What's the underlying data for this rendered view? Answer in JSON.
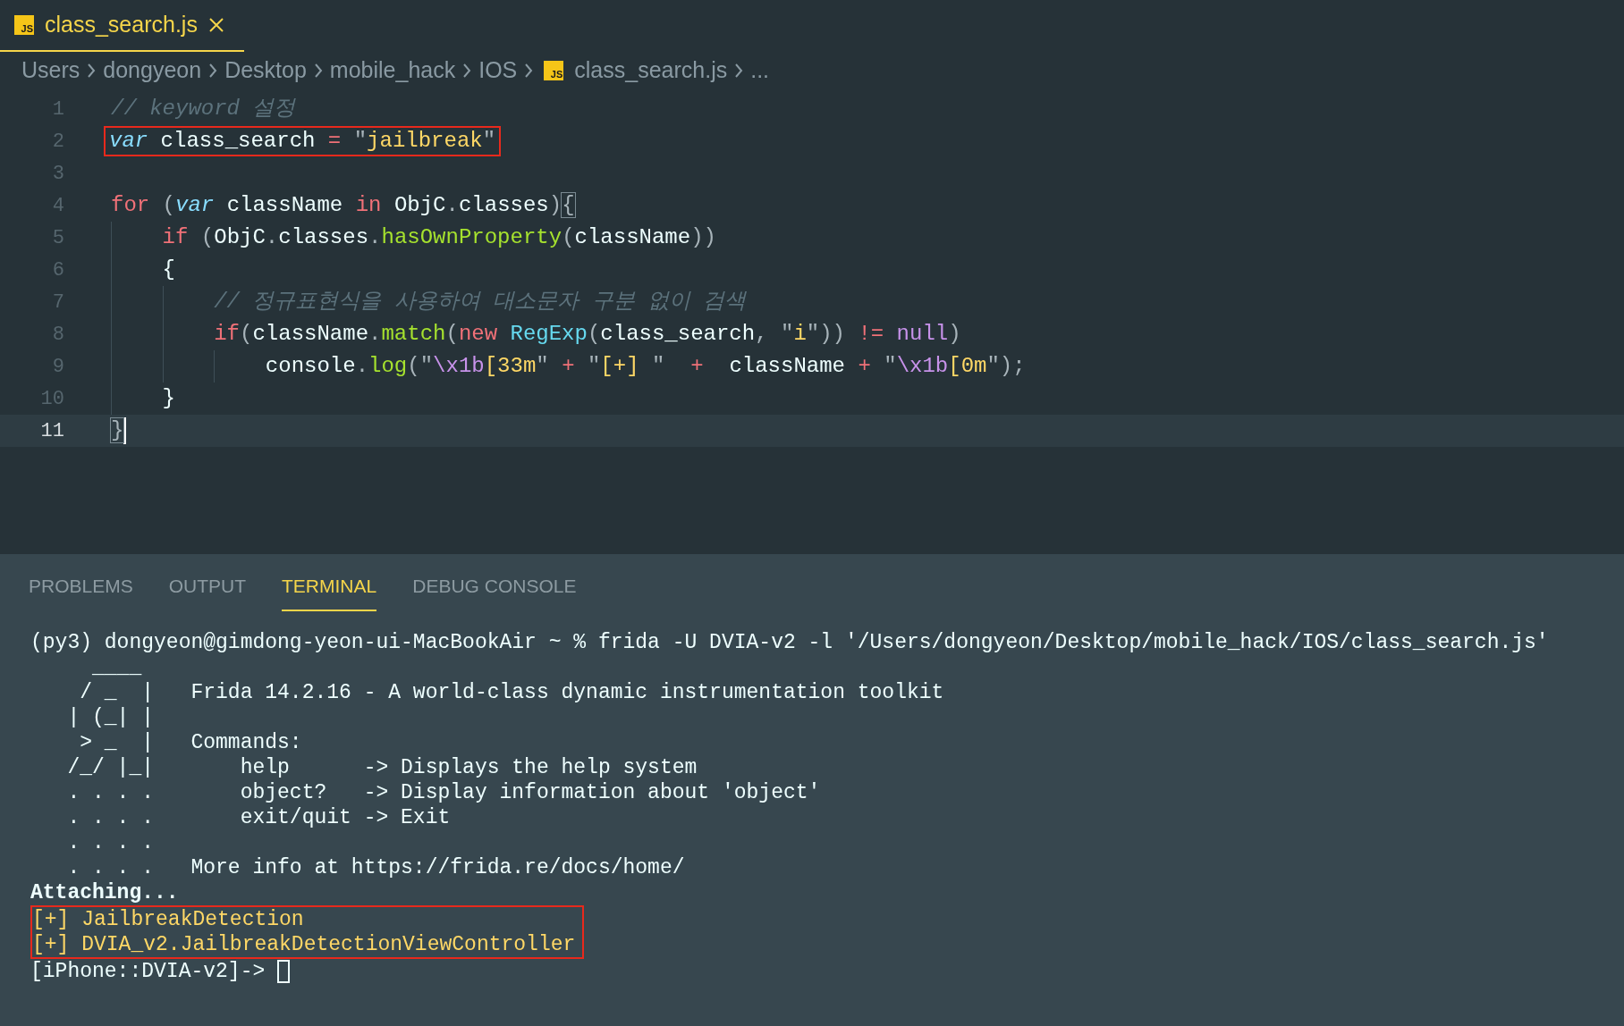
{
  "tabs": [
    {
      "label": "class_search.js",
      "icon_text": "JS",
      "selected": true
    }
  ],
  "breadcrumbs": [
    {
      "kind": "folder",
      "label": "Users"
    },
    {
      "kind": "folder",
      "label": "dongyeon"
    },
    {
      "kind": "folder",
      "label": "Desktop"
    },
    {
      "kind": "folder",
      "label": "mobile_hack"
    },
    {
      "kind": "folder",
      "label": "IOS"
    },
    {
      "kind": "file",
      "label": "class_search.js",
      "icon_text": "JS"
    },
    {
      "kind": "more",
      "label": "..."
    }
  ],
  "code": {
    "lines": [
      {
        "number": "1",
        "current": false,
        "highlighted": false,
        "tokens": [
          {
            "kind": "comment",
            "text": "// keyword 설정"
          }
        ]
      },
      {
        "number": "2",
        "current": false,
        "highlighted": true,
        "tokens": [
          {
            "kind": "storage",
            "text": "var"
          },
          {
            "kind": "plain",
            "text": " class_search "
          },
          {
            "kind": "operator",
            "text": "="
          },
          {
            "kind": "punct",
            "text": " \""
          },
          {
            "kind": "string",
            "text": "jailbreak"
          },
          {
            "kind": "punct",
            "text": "\""
          }
        ]
      },
      {
        "number": "3",
        "current": false,
        "highlighted": false
      },
      {
        "number": "4",
        "current": false,
        "highlighted": false,
        "tokens": [
          {
            "kind": "keyword",
            "text": "for"
          },
          {
            "kind": "punct",
            "text": " ("
          },
          {
            "kind": "storage",
            "text": "var"
          },
          {
            "kind": "plain",
            "text": " className "
          },
          {
            "kind": "keyword",
            "text": "in"
          },
          {
            "kind": "plain",
            "text": " ObjC"
          },
          {
            "kind": "punct",
            "text": "."
          },
          {
            "kind": "plain",
            "text": "classes"
          },
          {
            "kind": "punct",
            "text": ")"
          },
          {
            "kind": "bracket",
            "text": "{"
          }
        ]
      },
      {
        "number": "5",
        "current": false,
        "highlighted": false,
        "tokens": [
          {
            "kind": "keyword",
            "text": "    if"
          },
          {
            "kind": "punct",
            "text": " ("
          },
          {
            "kind": "plain",
            "text": "ObjC"
          },
          {
            "kind": "punct",
            "text": "."
          },
          {
            "kind": "plain",
            "text": "classes"
          },
          {
            "kind": "punct",
            "text": "."
          },
          {
            "kind": "function",
            "text": "hasOwnProperty"
          },
          {
            "kind": "punct",
            "text": "("
          },
          {
            "kind": "plain",
            "text": "className"
          },
          {
            "kind": "punct",
            "text": "))"
          }
        ]
      },
      {
        "number": "6",
        "current": false,
        "highlighted": false,
        "tokens": [
          {
            "kind": "plain",
            "text": "    {"
          }
        ]
      },
      {
        "number": "7",
        "current": false,
        "highlighted": false,
        "tokens": [
          {
            "kind": "comment",
            "text": "        // 정규표현식을 사용하여 대소문자 구분 없이 검색"
          }
        ]
      },
      {
        "number": "8",
        "current": false,
        "highlighted": false,
        "tokens": [
          {
            "kind": "keyword",
            "text": "        if"
          },
          {
            "kind": "punct",
            "text": "("
          },
          {
            "kind": "plain",
            "text": "className"
          },
          {
            "kind": "punct",
            "text": "."
          },
          {
            "kind": "function",
            "text": "match"
          },
          {
            "kind": "punct",
            "text": "("
          },
          {
            "kind": "keyword",
            "text": "new "
          },
          {
            "kind": "class",
            "text": "RegExp"
          },
          {
            "kind": "punct",
            "text": "("
          },
          {
            "kind": "plain",
            "text": "class_search"
          },
          {
            "kind": "punct",
            "text": ", \""
          },
          {
            "kind": "string",
            "text": "i"
          },
          {
            "kind": "punct",
            "text": "\")) "
          },
          {
            "kind": "operator",
            "text": "!= "
          },
          {
            "kind": "constant",
            "text": "null"
          },
          {
            "kind": "punct",
            "text": ")"
          }
        ]
      },
      {
        "number": "9",
        "current": false,
        "highlighted": false,
        "tokens": [
          {
            "kind": "plain",
            "text": "            console"
          },
          {
            "kind": "punct",
            "text": "."
          },
          {
            "kind": "function",
            "text": "log"
          },
          {
            "kind": "punct",
            "text": "(\""
          },
          {
            "kind": "escape",
            "text": "\\x1b"
          },
          {
            "kind": "string",
            "text": "[33m"
          },
          {
            "kind": "punct",
            "text": "\" "
          },
          {
            "kind": "operator",
            "text": "+ "
          },
          {
            "kind": "punct",
            "text": "\""
          },
          {
            "kind": "string",
            "text": "[+] "
          },
          {
            "kind": "punct",
            "text": "\"  "
          },
          {
            "kind": "operator",
            "text": "+"
          },
          {
            "kind": "plain",
            "text": "  className "
          },
          {
            "kind": "operator",
            "text": "+ "
          },
          {
            "kind": "punct",
            "text": "\""
          },
          {
            "kind": "escape",
            "text": "\\x1b"
          },
          {
            "kind": "string",
            "text": "[0m"
          },
          {
            "kind": "punct",
            "text": "\");"
          }
        ]
      },
      {
        "number": "10",
        "current": false,
        "highlighted": false,
        "tokens": [
          {
            "kind": "plain",
            "text": "    }"
          }
        ]
      },
      {
        "number": "11",
        "current": true,
        "highlighted": false,
        "tokens": [
          {
            "kind": "bracket",
            "text": "}"
          }
        ]
      }
    ]
  },
  "panel_tabs": [
    {
      "label": "PROBLEMS",
      "selected": false
    },
    {
      "label": "OUTPUT",
      "selected": false
    },
    {
      "label": "TERMINAL",
      "selected": true
    },
    {
      "label": "DEBUG CONSOLE",
      "selected": false
    }
  ],
  "terminal": {
    "lines": [
      {
        "kind": "text",
        "text": "(py3) dongyeon@gimdong-yeon-ui-MacBookAir ~ % frida -U DVIA-v2 -l '/Users/dongyeon/Desktop/mobile_hack/IOS/class_search.js'"
      },
      {
        "kind": "text",
        "text": "     ____"
      },
      {
        "kind": "text",
        "text": "    / _  |   Frida 14.2.16 - A world-class dynamic instrumentation toolkit"
      },
      {
        "kind": "text",
        "text": "   | (_| |"
      },
      {
        "kind": "text",
        "text": "    > _  |   Commands:"
      },
      {
        "kind": "text",
        "text": "   /_/ |_|       help      -> Displays the help system"
      },
      {
        "kind": "text",
        "text": "   . . . .       object?   -> Display information about 'object'"
      },
      {
        "kind": "text",
        "text": "   . . . .       exit/quit -> Exit"
      },
      {
        "kind": "text",
        "text": "   . . . ."
      },
      {
        "kind": "text",
        "text": "   . . . .   More info at https://frida.re/docs/home/"
      },
      {
        "kind": "bold",
        "text": "Attaching..."
      },
      {
        "kind": "boxed",
        "lines": [
          "[+] JailbreakDetection",
          "[+] DVIA_v2.JailbreakDetectionViewController"
        ]
      },
      {
        "kind": "prompt",
        "text": "[iPhone::DVIA-v2]-> "
      }
    ]
  }
}
